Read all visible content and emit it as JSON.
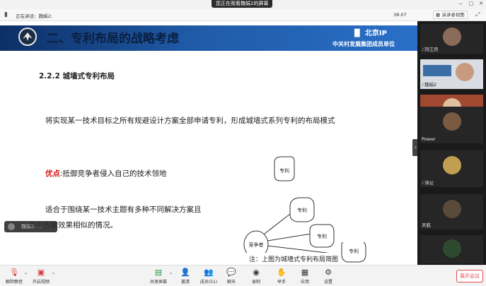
{
  "banner": "您正在观看魏娟2的屏幕",
  "window_controls": [
    "－",
    "□",
    "✕"
  ],
  "control_strip": {
    "speaking_label": "正在讲话：魏娟2;",
    "time": "38:07",
    "view_button": "演讲者视图"
  },
  "slide": {
    "title": "二、专利布局的战略考虑",
    "org_logo_text": "北京IP",
    "org_name": "中关村发展集团成员单位",
    "subtitle": "2.2.2  城墙式专利布局",
    "para1": "将实现某一技术目标之所有规避设计方案全部申请专利，形成城墙式系列专利的布局模式",
    "advantage_label": "优点",
    "advantage_text": ":抵御竞争者侵入自己的技术领地",
    "para2": "适合于围绕某一技术主题有多种不同解决方案且各个方案效果相似的情况。",
    "note": "注：上图为城墙式专利布局简图",
    "diagram": {
      "patent_label": "专利",
      "competitor_label": "竞争者"
    }
  },
  "chat_bubble": "魏娟2: ...",
  "participants": [
    {
      "name": "刘江月",
      "color": "#8a6b5a"
    },
    {
      "name": "魏娟2",
      "color": "#3a6ea5"
    },
    {
      "name": "",
      "color": "#a04830"
    },
    {
      "name": "Power",
      "color": "#7a5a40"
    },
    {
      "name": "沛公",
      "color": "#c0a050"
    },
    {
      "name": "天航",
      "color": "#5a4a3a"
    },
    {
      "name": "",
      "color": "#2e4a2e"
    }
  ],
  "toolbar": {
    "mute": "解除静音",
    "video": "开启视频",
    "share": "共享屏幕",
    "invite": "邀请",
    "members": "成员(51)",
    "chat": "聊天",
    "record": "录制",
    "raise_hand": "举手",
    "apps": "应用",
    "settings": "设置",
    "leave": "离开会议"
  }
}
